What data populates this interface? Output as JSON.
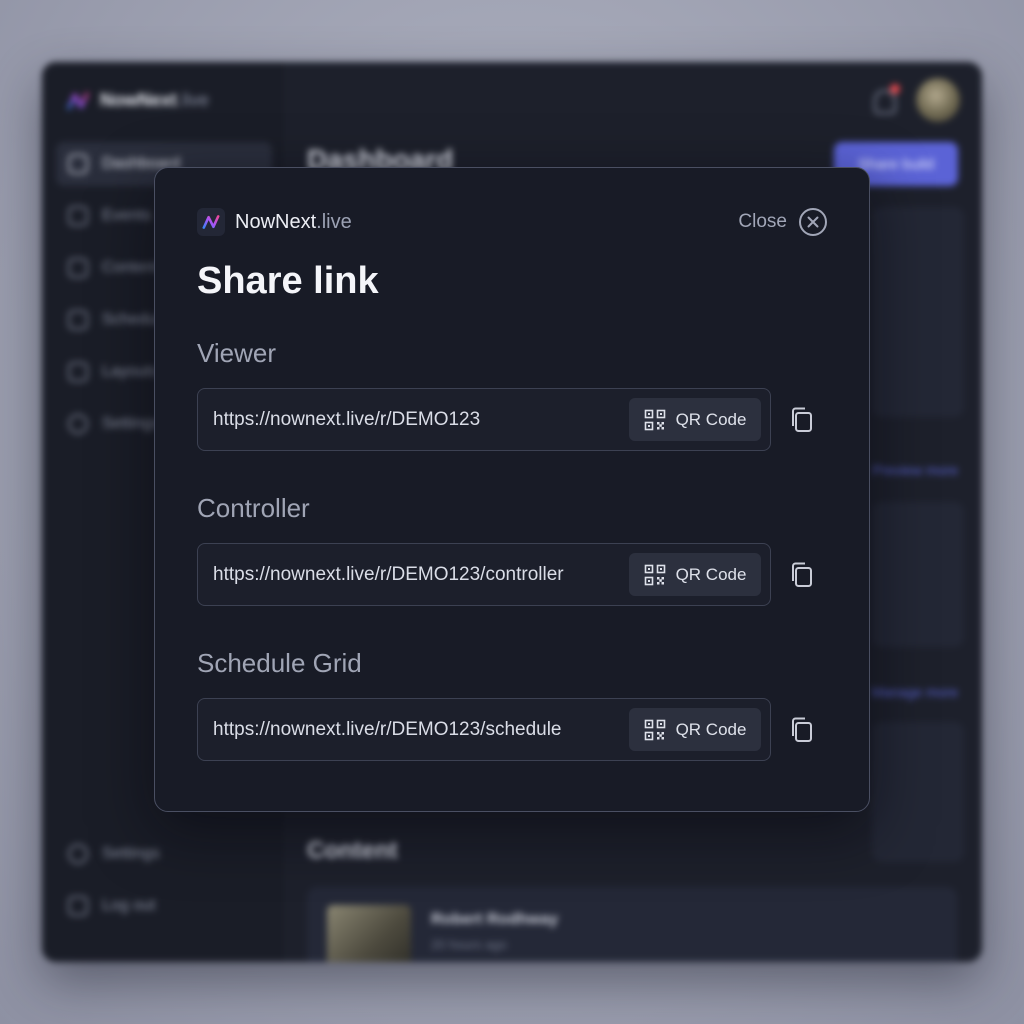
{
  "background_app": {
    "brand": {
      "name": "NowNext",
      "suffix": ".live"
    },
    "nav": [
      {
        "label": "Dashboard",
        "active": true
      },
      {
        "label": "Events"
      },
      {
        "label": "Content"
      },
      {
        "label": "Schedule"
      },
      {
        "label": "Layouts"
      },
      {
        "label": "Settings"
      }
    ],
    "nav_bottom": [
      {
        "label": "Settings"
      },
      {
        "label": "Log out"
      }
    ],
    "page_title": "Dashboard",
    "primary_button": "Share build",
    "view_all_1": "Preview more",
    "view_all_2": "Manage more",
    "content_title": "Content",
    "content_item": {
      "name": "Robert Rodhway",
      "meta": "20 hours ago"
    }
  },
  "modal": {
    "brand": {
      "name": "NowNext",
      "suffix": ".live"
    },
    "close_label": "Close",
    "title": "Share link",
    "qr_label": "QR Code",
    "sections": [
      {
        "label": "Viewer",
        "url": "https://nownext.live/r/DEMO123"
      },
      {
        "label": "Controller",
        "url": "https://nownext.live/r/DEMO123/controller"
      },
      {
        "label": "Schedule Grid",
        "url": "https://nownext.live/r/DEMO123/schedule"
      }
    ]
  },
  "colors": {
    "modal_bg": "#181b26",
    "accent": "#5b63d6",
    "logo_gradient": [
      "#3b82f6",
      "#a855f7",
      "#ec4899"
    ]
  }
}
